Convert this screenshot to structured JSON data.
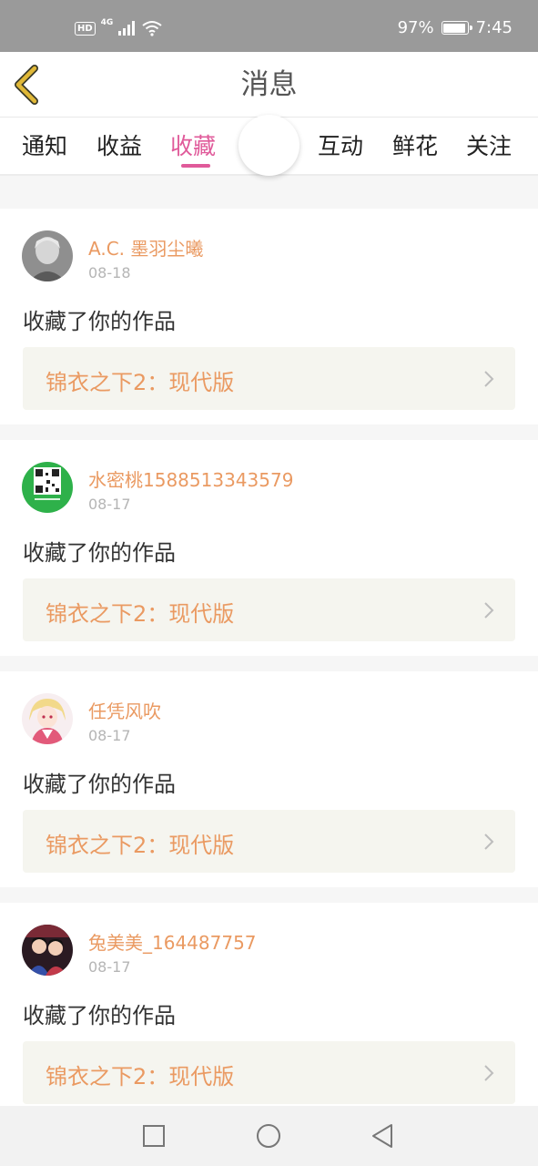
{
  "status_bar": {
    "hd": "HD",
    "network": "4G",
    "battery_percent_label": "97%",
    "battery_level": 0.97,
    "time": "7:45",
    "icons": [
      "signal-icon",
      "wifi-icon",
      "battery-icon"
    ]
  },
  "header": {
    "title": "消息",
    "back_icon": "chevron-left-icon",
    "accent": "#e0b838"
  },
  "tabs": [
    {
      "label": "通知",
      "active": false
    },
    {
      "label": "收益",
      "active": false
    },
    {
      "label": "收藏",
      "active": true
    },
    {
      "label": "互动",
      "active": false
    },
    {
      "label": "鲜花",
      "active": false
    },
    {
      "label": "关注",
      "active": false
    }
  ],
  "colors": {
    "active_tab": "#e05a9a",
    "username": "#ea9a62",
    "work_title": "#ea9a62",
    "date": "#b5b5b5"
  },
  "messages": [
    {
      "username": "A.C. 墨羽尘曦",
      "date": "08-18",
      "action": "收藏了你的作品",
      "work": "锦衣之下2：现代版",
      "avatar": "avatar-grey-portrait"
    },
    {
      "username": "水密桃1588513343579",
      "date": "08-17",
      "action": "收藏了你的作品",
      "work": "锦衣之下2：现代版",
      "avatar": "avatar-green-qr"
    },
    {
      "username": "任凭风吹",
      "date": "08-17",
      "action": "收藏了你的作品",
      "work": "锦衣之下2：现代版",
      "avatar": "avatar-anime-girl"
    },
    {
      "username": "兔美美_164487757",
      "date": "08-17",
      "action": "收藏了你的作品",
      "work": "锦衣之下2：现代版",
      "avatar": "avatar-couple-photo"
    }
  ],
  "nav_bar": {
    "icons": [
      "recents-square-icon",
      "home-circle-icon",
      "back-triangle-icon"
    ]
  }
}
